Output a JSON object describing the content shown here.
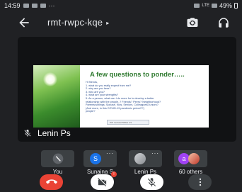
{
  "status_bar": {
    "time": "14:59",
    "battery": "49%",
    "network": "LTE"
  },
  "header": {
    "meeting_code": "rmt-rwpc-kqe",
    "caret": "▸",
    "icons": {
      "back": "arrow-back-icon",
      "switch_camera": "switch-camera-icon",
      "audio": "headphones-icon"
    }
  },
  "presentation": {
    "title": "A few questions to ponder…..",
    "lines": [
      "Hi friends,",
      "1. what do you really expect from me?",
      "2. why are you here?",
      "3. who are you?",
      "4. what are your strengths?",
      "5. As a person, what can I do more for to develop a better",
      "relationship with the people..? Friends? Peers? Neighborhood?",
      "Parents/siblings, Spouse, Kids, Seniors, Colleagues/Juniors?",
      "(And more, in this COVID-19 pandemic period??)",
      "people?"
    ],
    "footer": "P.B. Lecturer/Slides 1/1"
  },
  "main_tile": {
    "presenter_name": "Lenin Ps",
    "mic_state": "muted"
  },
  "participants": [
    {
      "name": "You",
      "avatar_color": "#5f6368",
      "avatar_text": ""
    },
    {
      "name": "Sunaina S",
      "avatar_color": "#1a73e8",
      "avatar_text": "S"
    },
    {
      "name": "Lenin Ps",
      "avatar_color": "#9aa0a6",
      "avatar_text": ""
    },
    {
      "name": "60 others",
      "avatar_color": "#a142f4",
      "avatar_text": "a"
    }
  ],
  "controls": {
    "end_call": "end-call-icon",
    "camera": "camera-off-icon",
    "mic": "mic-off-icon",
    "more": "more-vert-icon",
    "camera_badge": "!"
  },
  "colors": {
    "background": "#202124",
    "end_call": "#ea4335",
    "tile": "#3c4043",
    "slide_title": "#2f7a2f",
    "slide_text": "#2d4f8f"
  }
}
